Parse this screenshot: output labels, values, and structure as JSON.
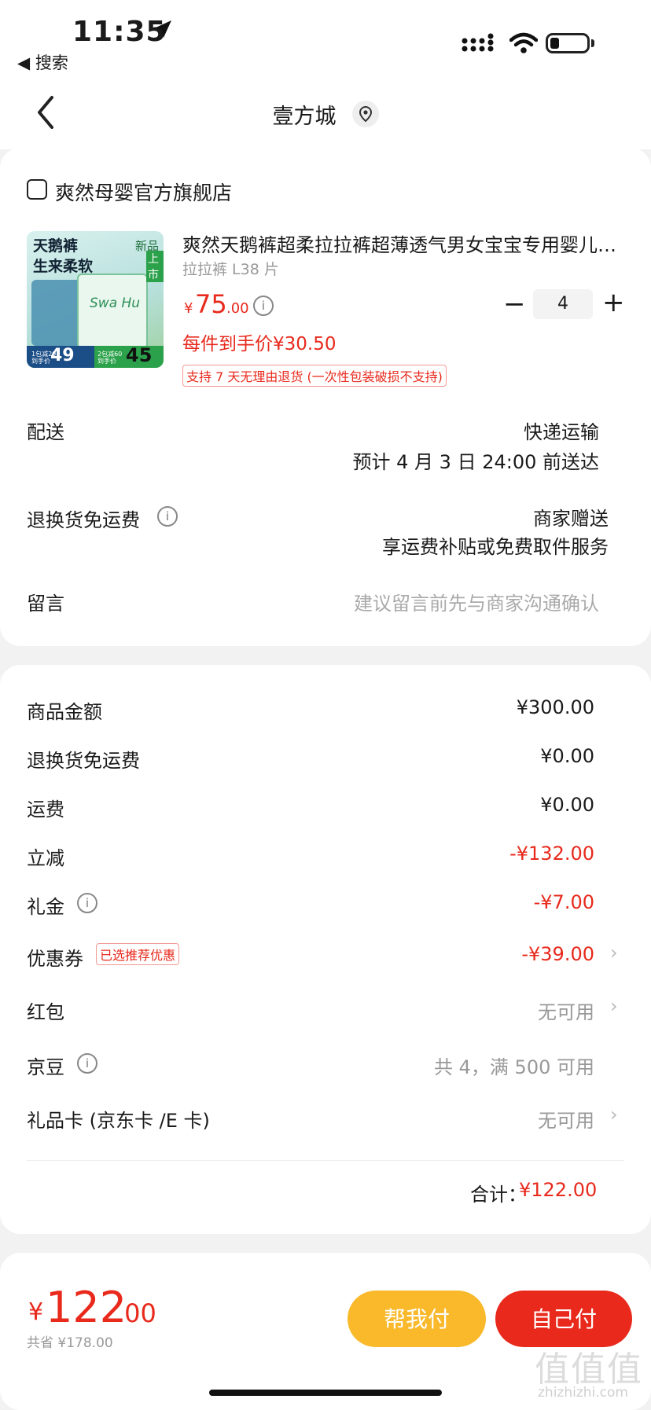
{
  "status_bar": {
    "time": "11:35",
    "back_app": "◀ 搜索"
  },
  "nav": {
    "title": "壹方城"
  },
  "shop": {
    "name": "爽然母婴官方旗舰店"
  },
  "product": {
    "image_text": {
      "line1": "天鹅裤",
      "line2": "生来柔软",
      "badge_new": "新品",
      "badge_launch": "上市",
      "brand_script": "Swa Hu",
      "price_left": "49",
      "price_right": "45",
      "left_small": "1包减20\n到手价",
      "right_small": "2包减60\n到手价"
    },
    "title": "爽然天鹅裤超柔拉拉裤超薄透气男女宝宝专用婴儿尿不湿",
    "spec": "拉拉裤 L38 片",
    "price_symbol": "¥",
    "price_int": "75",
    "price_dec": ".00",
    "quantity": "4",
    "unit_price": "每件到手价¥30.50",
    "return_tag": "支持 7 天无理由退货 (一次性包装破损不支持)"
  },
  "delivery": {
    "label": "配送",
    "method": "快递运输",
    "eta": "预计 4 月 3 日 24:00 前送达"
  },
  "return_shipping": {
    "label": "退换货免运费",
    "value1": "商家赠送",
    "value2": "享运费补贴或免费取件服务"
  },
  "message": {
    "label": "留言",
    "placeholder": "建议留言前先与商家沟通确认"
  },
  "summary": {
    "goods_label": "商品金额",
    "goods_value": "¥300.00",
    "return_fee_label": "退换货免运费",
    "return_fee_value": "¥0.00",
    "freight_label": "运费",
    "freight_value": "¥0.00",
    "discount_label": "立减",
    "discount_value": "-¥132.00",
    "gift_label": "礼金",
    "gift_value": "-¥7.00",
    "coupon_label": "优惠券",
    "coupon_tag": "已选推荐优惠",
    "coupon_value": "-¥39.00",
    "redpacket_label": "红包",
    "redpacket_value": "无可用",
    "jingdou_label": "京豆",
    "jingdou_value": "共 4，满 500 可用",
    "giftcard_label": "礼品卡 (京东卡 /E 卡)",
    "giftcard_value": "无可用",
    "total_label": "合计：",
    "total_value": "¥122.00"
  },
  "pay_bar": {
    "yen": "¥",
    "int": "122",
    "dec": ".00",
    "save": "共省 ¥178.00",
    "help_pay": "帮我付",
    "self_pay": "自己付"
  },
  "watermark": {
    "main": "值值值",
    "sub": "zhizhizhi.com"
  },
  "colors": {
    "accent_red": "#e8291c",
    "help_yellow": "#f9b92b"
  }
}
